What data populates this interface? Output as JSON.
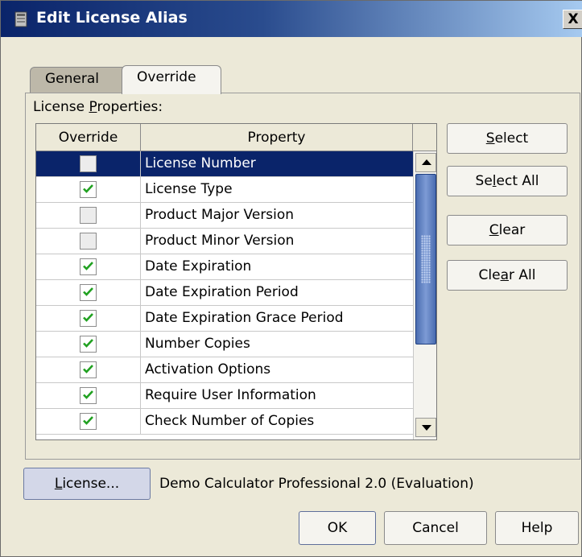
{
  "window": {
    "title": "Edit License Alias",
    "close_label": "X"
  },
  "tabs": [
    {
      "label": "General",
      "active": false
    },
    {
      "label": "Override",
      "active": true
    }
  ],
  "properties_label": {
    "pre": "License ",
    "mnemonic": "P",
    "post": "roperties:"
  },
  "table": {
    "columns": [
      "Override",
      "Property"
    ],
    "rows": [
      {
        "checked": false,
        "property": "License Number",
        "selected": true
      },
      {
        "checked": true,
        "property": "License Type"
      },
      {
        "checked": false,
        "property": "Product Major Version"
      },
      {
        "checked": false,
        "property": "Product Minor Version"
      },
      {
        "checked": true,
        "property": "Date Expiration"
      },
      {
        "checked": true,
        "property": "Date Expiration Period"
      },
      {
        "checked": true,
        "property": "Date Expiration Grace Period"
      },
      {
        "checked": true,
        "property": "Number Copies"
      },
      {
        "checked": true,
        "property": "Activation Options"
      },
      {
        "checked": true,
        "property": "Require User Information"
      },
      {
        "checked": true,
        "property": "Check Number of Copies"
      }
    ]
  },
  "side_buttons": {
    "select": {
      "pre": "",
      "mnemonic": "S",
      "post": "elect"
    },
    "select_all": {
      "pre": "Se",
      "mnemonic": "l",
      "post": "ect All"
    },
    "clear": {
      "pre": "",
      "mnemonic": "C",
      "post": "lear"
    },
    "clear_all": {
      "pre": "Cle",
      "mnemonic": "a",
      "post": "r All"
    }
  },
  "license": {
    "button": {
      "pre": "",
      "mnemonic": "L",
      "post": "icense..."
    },
    "name": "Demo Calculator Professional 2.0 (Evaluation)"
  },
  "footer": {
    "ok": "OK",
    "cancel": "Cancel",
    "help": "Help"
  },
  "colors": {
    "selection": "#0a246a",
    "title_bar_start": "#0a246a",
    "dialog_bg": "#ece9d8"
  }
}
